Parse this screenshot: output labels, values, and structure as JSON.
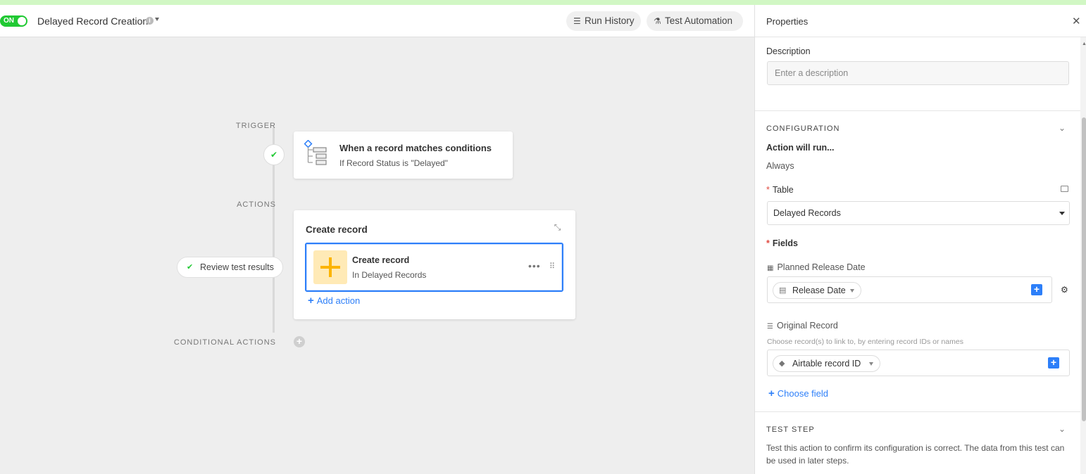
{
  "header": {
    "toggle_label": "ON",
    "automation_name": "Delayed Record Creation",
    "run_history_label": "Run History",
    "test_automation_label": "Test Automation"
  },
  "canvas": {
    "trigger_label": "TRIGGER",
    "actions_label": "ACTIONS",
    "conditional_actions_label": "CONDITIONAL ACTIONS",
    "trigger": {
      "title": "When a record matches conditions",
      "subtitle": "If Record Status is \"Delayed\""
    },
    "actions_group": {
      "title": "Create record",
      "item": {
        "title": "Create record",
        "subtitle": "In Delayed Records"
      },
      "add_action_label": "Add action"
    },
    "review_label": "Review test results"
  },
  "panel": {
    "title": "Properties",
    "description_label": "Description",
    "description_placeholder": "Enter a description",
    "configuration_heading": "CONFIGURATION",
    "action_will_run_label": "Action will run...",
    "action_will_run_value": "Always",
    "table_label": "Table",
    "table_value": "Delayed Records",
    "fields_label": "Fields",
    "field1": {
      "name": "Planned Release Date",
      "value": "Release Date"
    },
    "field2": {
      "name": "Original Record",
      "hint": "Choose record(s) to link to, by entering record IDs or names",
      "value": "Airtable record ID"
    },
    "choose_field_label": "Choose field",
    "test_step_heading": "TEST STEP",
    "test_step_description": "Test this action to confirm its configuration is correct. The data from this test can be used in later steps."
  },
  "colors": {
    "accent_blue": "#2d7ff9",
    "success_green": "#20c933",
    "action_yellow": "#fcb400",
    "top_strip": "#d1f7c4"
  }
}
